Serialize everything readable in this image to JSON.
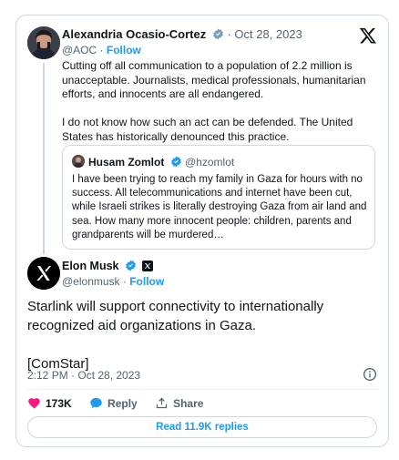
{
  "parent": {
    "author_name": "Alexandria Ocasio-Cortez",
    "date": "· Oct 28, 2023",
    "handle": "@AOC",
    "separator": " · ",
    "follow": "Follow",
    "paragraphs": [
      "Cutting off all communication to a population of 2.2 million is unacceptable. Journalists, medical professionals, humanitarian efforts, and innocents are all endangered.",
      "I do not know how such an act can be defended. The United States has historically denounced this practice."
    ]
  },
  "quote": {
    "author_name": "Husam Zomlot",
    "handle": "@hzomlot",
    "text": "I have been trying to reach my family in Gaza for hours with no success. All telecommunications and internet have been cut, while Israeli strikes is literally destroying Gaza from air land and sea. How many more innocent people: children, parents and grandparents will be murdered…"
  },
  "main": {
    "author_name": "Elon Musk",
    "handle": "@elonmusk",
    "separator": " · ",
    "follow": "Follow",
    "paragraphs": [
      "Starlink will support connectivity to internationally recognized aid organizations in Gaza.",
      "[ComStar]"
    ],
    "timestamp": "2:12 PM · Oct 28, 2023"
  },
  "actions": {
    "likes": "173K",
    "reply": "Reply",
    "share": "Share"
  },
  "read_replies": "Read 11.9K replies",
  "colors": {
    "link": "#1d9bf0",
    "like": "#f91880",
    "text": "#0f1419",
    "secondary": "#536471",
    "border": "#cfd9de"
  },
  "icons": [
    "verified-badge-icon",
    "x-logo-icon",
    "info-icon",
    "heart-icon",
    "reply-bubble-icon",
    "share-icon",
    "affiliate-badge-icon"
  ]
}
